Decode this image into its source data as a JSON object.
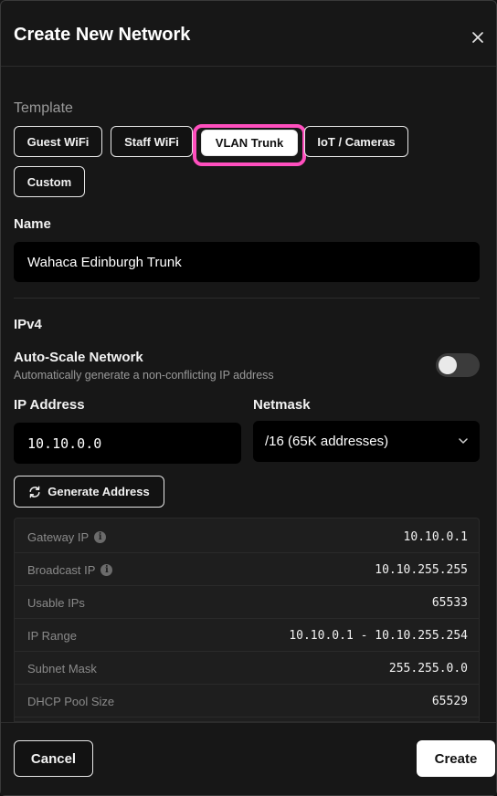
{
  "dialog": {
    "title": "Create New Network"
  },
  "template": {
    "section_label": "Template",
    "options": [
      {
        "label": "Guest WiFi",
        "selected": false
      },
      {
        "label": "Staff WiFi",
        "selected": false
      },
      {
        "label": "VLAN Trunk",
        "selected": true
      },
      {
        "label": "IoT / Cameras",
        "selected": false
      },
      {
        "label": "Custom",
        "selected": false
      }
    ]
  },
  "name": {
    "label": "Name",
    "value": "Wahaca Edinburgh Trunk"
  },
  "ipv4": {
    "section_label": "IPv4",
    "auto_scale": {
      "label": "Auto-Scale Network",
      "description": "Automatically generate a non-conflicting IP address",
      "enabled": false
    },
    "ip_address": {
      "label": "IP Address",
      "value": "10.10.0.0"
    },
    "netmask": {
      "label": "Netmask",
      "value": "/16 (65K addresses)"
    },
    "generate_label": "Generate Address",
    "details": [
      {
        "label": "Gateway IP",
        "value": "10.10.0.1",
        "info": true
      },
      {
        "label": "Broadcast IP",
        "value": "10.10.255.255",
        "info": true
      },
      {
        "label": "Usable IPs",
        "value": "65533",
        "info": false
      },
      {
        "label": "IP Range",
        "value": "10.10.0.1 - 10.10.255.254",
        "info": false
      },
      {
        "label": "Subnet Mask",
        "value": "255.255.0.0",
        "info": false
      },
      {
        "label": "DHCP Pool Size",
        "value": "65529",
        "info": false
      }
    ]
  },
  "footer": {
    "cancel_label": "Cancel",
    "create_label": "Create"
  },
  "colors": {
    "highlight": "#ff4fbe",
    "background": "#171717",
    "input_background": "#000000"
  }
}
